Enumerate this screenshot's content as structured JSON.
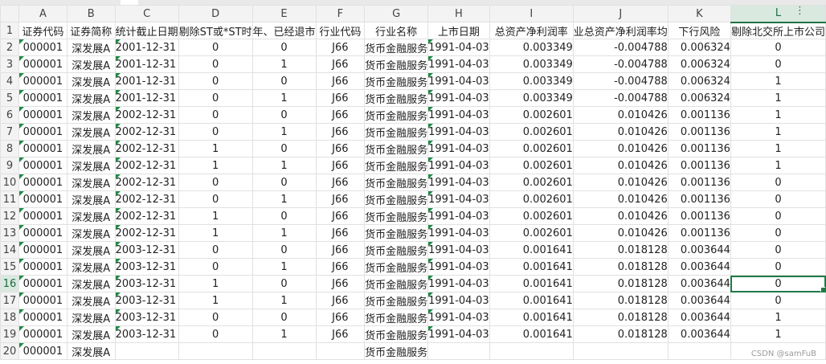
{
  "sheet": {
    "columns": [
      "A",
      "B",
      "C",
      "D",
      "E",
      "F",
      "G",
      "H",
      "I",
      "J",
      "K",
      "L"
    ],
    "headers": [
      "证券代码",
      "证券简称",
      "统计截止日期",
      "剔除ST或*ST时",
      "年、已经退市",
      "行业代码",
      "行业名称",
      "上市日期",
      "总资产净利润率",
      "业总资产净利润率均",
      "下行风险",
      "剔除北交所上市公司"
    ],
    "rows": [
      {
        "r": "1"
      },
      {
        "r": "2",
        "v": [
          "000001",
          "深发展A",
          "2001-12-31",
          "0",
          "0",
          "J66",
          "货币金融服务",
          "1991-04-03",
          "0.003349",
          "-0.004788",
          "0.006324",
          "0"
        ]
      },
      {
        "r": "3",
        "v": [
          "000001",
          "深发展A",
          "2001-12-31",
          "0",
          "1",
          "J66",
          "货币金融服务",
          "1991-04-03",
          "0.003349",
          "-0.004788",
          "0.006324",
          "0"
        ]
      },
      {
        "r": "4",
        "v": [
          "000001",
          "深发展A",
          "2001-12-31",
          "0",
          "0",
          "J66",
          "货币金融服务",
          "1991-04-03",
          "0.003349",
          "-0.004788",
          "0.006324",
          "1"
        ]
      },
      {
        "r": "5",
        "v": [
          "000001",
          "深发展A",
          "2001-12-31",
          "0",
          "1",
          "J66",
          "货币金融服务",
          "1991-04-03",
          "0.003349",
          "-0.004788",
          "0.006324",
          "1"
        ]
      },
      {
        "r": "6",
        "v": [
          "000001",
          "深发展A",
          "2002-12-31",
          "0",
          "0",
          "J66",
          "货币金融服务",
          "1991-04-03",
          "0.002601",
          "0.010426",
          "0.001136",
          "1"
        ]
      },
      {
        "r": "7",
        "v": [
          "000001",
          "深发展A",
          "2002-12-31",
          "0",
          "1",
          "J66",
          "货币金融服务",
          "1991-04-03",
          "0.002601",
          "0.010426",
          "0.001136",
          "1"
        ]
      },
      {
        "r": "8",
        "v": [
          "000001",
          "深发展A",
          "2002-12-31",
          "1",
          "0",
          "J66",
          "货币金融服务",
          "1991-04-03",
          "0.002601",
          "0.010426",
          "0.001136",
          "1"
        ]
      },
      {
        "r": "9",
        "v": [
          "000001",
          "深发展A",
          "2002-12-31",
          "1",
          "1",
          "J66",
          "货币金融服务",
          "1991-04-03",
          "0.002601",
          "0.010426",
          "0.001136",
          "1"
        ]
      },
      {
        "r": "10",
        "v": [
          "000001",
          "深发展A",
          "2002-12-31",
          "0",
          "0",
          "J66",
          "货币金融服务",
          "1991-04-03",
          "0.002601",
          "0.010426",
          "0.001136",
          "0"
        ]
      },
      {
        "r": "11",
        "v": [
          "000001",
          "深发展A",
          "2002-12-31",
          "0",
          "1",
          "J66",
          "货币金融服务",
          "1991-04-03",
          "0.002601",
          "0.010426",
          "0.001136",
          "0"
        ]
      },
      {
        "r": "12",
        "v": [
          "000001",
          "深发展A",
          "2002-12-31",
          "1",
          "0",
          "J66",
          "货币金融服务",
          "1991-04-03",
          "0.002601",
          "0.010426",
          "0.001136",
          "0"
        ]
      },
      {
        "r": "13",
        "v": [
          "000001",
          "深发展A",
          "2002-12-31",
          "1",
          "1",
          "J66",
          "货币金融服务",
          "1991-04-03",
          "0.002601",
          "0.010426",
          "0.001136",
          "0"
        ]
      },
      {
        "r": "14",
        "v": [
          "000001",
          "深发展A",
          "2003-12-31",
          "0",
          "0",
          "J66",
          "货币金融服务",
          "1991-04-03",
          "0.001641",
          "0.018128",
          "0.003644",
          "0"
        ]
      },
      {
        "r": "15",
        "v": [
          "000001",
          "深发展A",
          "2003-12-31",
          "0",
          "1",
          "J66",
          "货币金融服务",
          "1991-04-03",
          "0.001641",
          "0.018128",
          "0.003644",
          "0"
        ]
      },
      {
        "r": "16",
        "v": [
          "000001",
          "深发展A",
          "2003-12-31",
          "1",
          "0",
          "J66",
          "货币金融服务",
          "1991-04-03",
          "0.001641",
          "0.018128",
          "0.003644",
          "0"
        ]
      },
      {
        "r": "17",
        "v": [
          "000001",
          "深发展A",
          "2003-12-31",
          "1",
          "1",
          "J66",
          "货币金融服务",
          "1991-04-03",
          "0.001641",
          "0.018128",
          "0.003644",
          "0"
        ]
      },
      {
        "r": "18",
        "v": [
          "000001",
          "深发展A",
          "2003-12-31",
          "0",
          "0",
          "J66",
          "货币金融服务",
          "1991-04-03",
          "0.001641",
          "0.018128",
          "0.003644",
          "1"
        ]
      },
      {
        "r": "19",
        "v": [
          "000001",
          "深发展A",
          "2003-12-31",
          "0",
          "1",
          "J66",
          "货币金融服务",
          "1991-04-03",
          "0.001641",
          "0.018128",
          "0.003644",
          "1"
        ]
      },
      {
        "r": "20",
        "v": [
          "000001",
          "深发展A",
          "",
          "",
          "",
          "",
          "货币金融服务",
          "",
          "",
          "",
          "",
          ""
        ]
      }
    ],
    "active_column": "L",
    "active_row": "16",
    "selected_cell_value": "0"
  },
  "menu_icon": "kebab-menu-icon",
  "watermark": "CSDN @samFuB",
  "colors": {
    "accent": "#217346",
    "error_triangle": "#1f8a46"
  }
}
